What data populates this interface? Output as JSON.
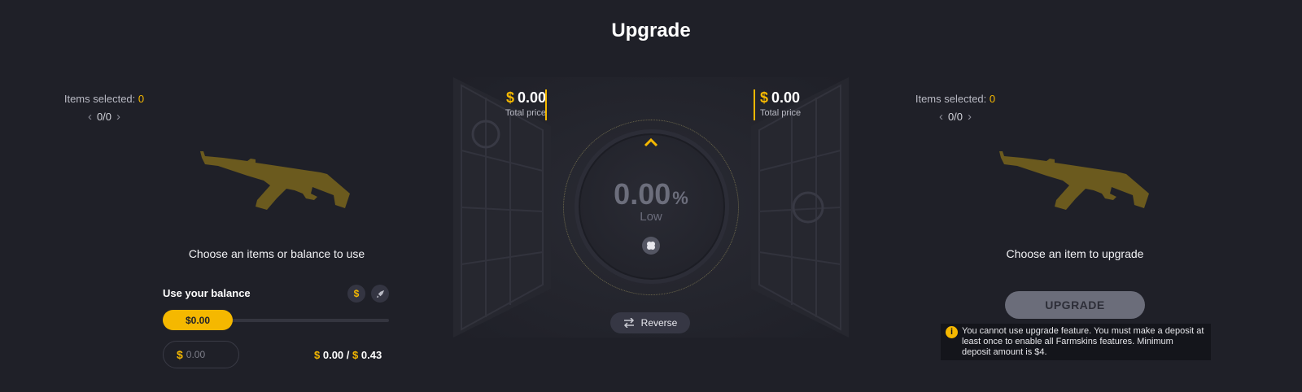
{
  "page": {
    "title": "Upgrade"
  },
  "left": {
    "items_selected_label": "Items selected:",
    "items_selected_count": "0",
    "pager": {
      "prev": "‹",
      "value": "0/0",
      "next": "›"
    },
    "choose_text": "Choose an items or balance to use",
    "balance": {
      "title": "Use your balance",
      "currency_icon": "$",
      "slider_value": "$0.00",
      "input_currency": "$",
      "input_placeholder": "0.00",
      "current": "0.00",
      "separator": "/",
      "max": "0.43",
      "currency": "$"
    }
  },
  "center": {
    "left_price": {
      "currency": "$",
      "amount": "0.00",
      "label": "Total price"
    },
    "right_price": {
      "currency": "$",
      "amount": "0.00",
      "label": "Total price"
    },
    "chance": "0.00",
    "chance_unit": "%",
    "chance_level": "Low",
    "reverse_label": "Reverse"
  },
  "right": {
    "items_selected_label": "Items selected:",
    "items_selected_count": "0",
    "pager": {
      "prev": "‹",
      "value": "0/0",
      "next": "›"
    },
    "choose_text": "Choose an item to upgrade",
    "upgrade_label": "UPGRADE",
    "warning": "You cannot use upgrade feature. You must make a deposit at least once to enable all Farmskins features. Minimum deposit amount is $4."
  },
  "colors": {
    "accent": "#f5b800",
    "background": "#1f2028",
    "rifle": "#6b5a1e"
  },
  "icons": [
    "chevron-left-icon",
    "chevron-right-icon",
    "rifle-icon",
    "dollar-icon",
    "rocket-icon",
    "chevron-up-icon",
    "clover-icon",
    "swap-icon",
    "info-icon"
  ]
}
